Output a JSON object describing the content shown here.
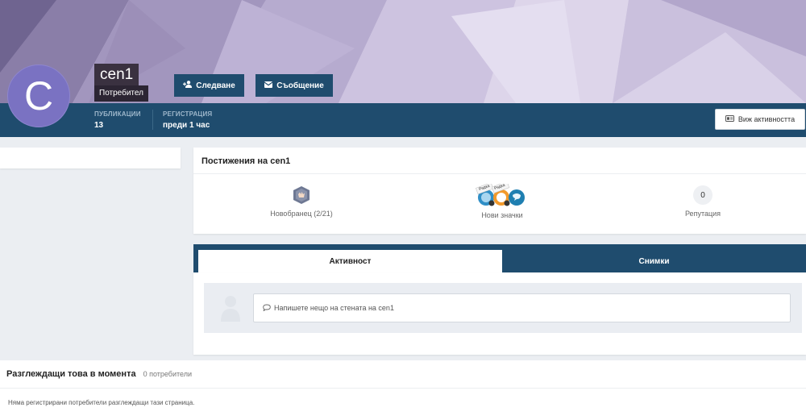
{
  "profile": {
    "avatar_letter": "C",
    "username": "cen1",
    "role": "Потребител",
    "follow_label": "Следване",
    "message_label": "Съобщение",
    "avatar_color": "#7a72c2"
  },
  "stats": {
    "posts_label": "ПУБЛИКАЦИИ",
    "posts_value": "13",
    "registered_label": "РЕГИСТРАЦИЯ",
    "registered_value": "преди 1 час",
    "activity_button": "Виж активността"
  },
  "achievements": {
    "title": "Постижения на cen1",
    "rank_label": "Новобранец (2/21)",
    "badges_label": "Нови значки",
    "badge_tag_1": "Рядка",
    "badge_tag_2": "Рядка",
    "reputation_value": "0",
    "reputation_label": "Репутация"
  },
  "tabs": {
    "activity": "Активност",
    "photos": "Снимки"
  },
  "wall": {
    "placeholder": "Напишете нещо на стената на cen1"
  },
  "viewing": {
    "title": "Разглеждащи това в момента",
    "count": "0 потребители",
    "empty": "Няма регистрирани потребители разглеждащи тази страница."
  },
  "colors": {
    "primary": "#1f4c6e",
    "background": "#ebeef2",
    "avatar": "#7a72c2"
  },
  "icons": {
    "follow": "user-plus-icon",
    "message": "envelope-icon",
    "activity": "id-card-icon",
    "rank": "shield-hand-icon",
    "wall": "speech-bubble-icon"
  }
}
